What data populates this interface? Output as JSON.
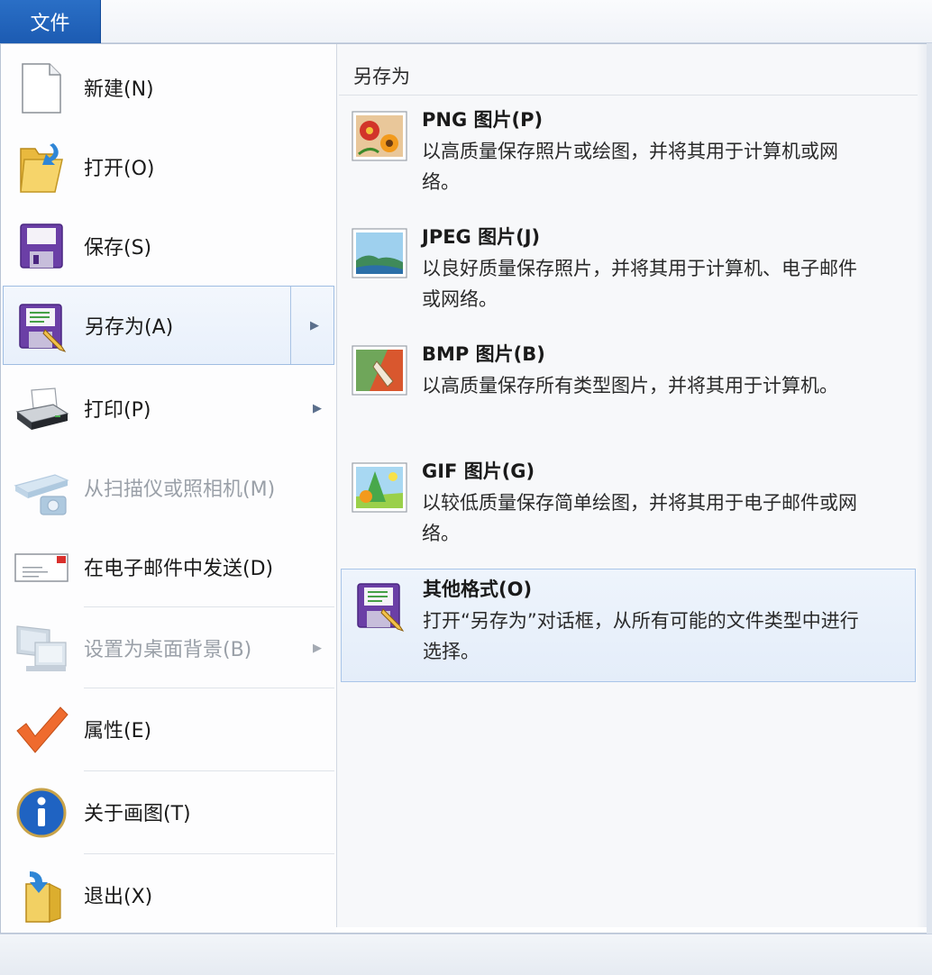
{
  "ribbon": {
    "file_tab": "文件"
  },
  "left_menu": {
    "new": "新建(N)",
    "open": "打开(O)",
    "save": "保存(S)",
    "save_as": "另存为(A)",
    "print": "打印(P)",
    "from_scanner": "从扫描仪或照相机(M)",
    "send_email": "在电子邮件中发送(D)",
    "set_desktop": "设置为桌面背景(B)",
    "properties": "属性(E)",
    "about": "关于画图(T)",
    "exit": "退出(X)",
    "submenu_arrow": "▶"
  },
  "save_as_panel": {
    "title": "另存为",
    "formats": [
      {
        "title": "PNG 图片(P)",
        "desc": "以高质量保存照片或绘图，并将其用于计算机或网络。"
      },
      {
        "title": "JPEG 图片(J)",
        "desc": "以良好质量保存照片，并将其用于计算机、电子邮件或网络。"
      },
      {
        "title": "BMP 图片(B)",
        "desc": "以高质量保存所有类型图片，并将其用于计算机。"
      },
      {
        "title": "GIF 图片(G)",
        "desc": "以较低质量保存简单绘图，并将其用于电子邮件或网络。"
      },
      {
        "title": "其他格式(O)",
        "desc": "打开“另存为”对话框，从所有可能的文件类型中进行选择。"
      }
    ]
  },
  "icons": {
    "new": "blank-document-icon",
    "open": "open-folder-icon",
    "save": "floppy-disk-icon",
    "save_as": "floppy-pencil-icon",
    "print": "printer-icon",
    "scanner": "scanner-camera-icon",
    "email": "envelope-icon",
    "desktop": "monitor-icon",
    "properties": "checkmark-icon",
    "about": "info-icon",
    "exit": "exit-door-icon",
    "png": "png-image-icon",
    "jpeg": "jpeg-image-icon",
    "bmp": "bmp-image-icon",
    "gif": "gif-image-icon",
    "other": "floppy-pencil-icon"
  },
  "colors": {
    "accent": "#1c5bb2",
    "hover_border": "#9fbde2",
    "disabled_text": "#9aa0a8"
  }
}
